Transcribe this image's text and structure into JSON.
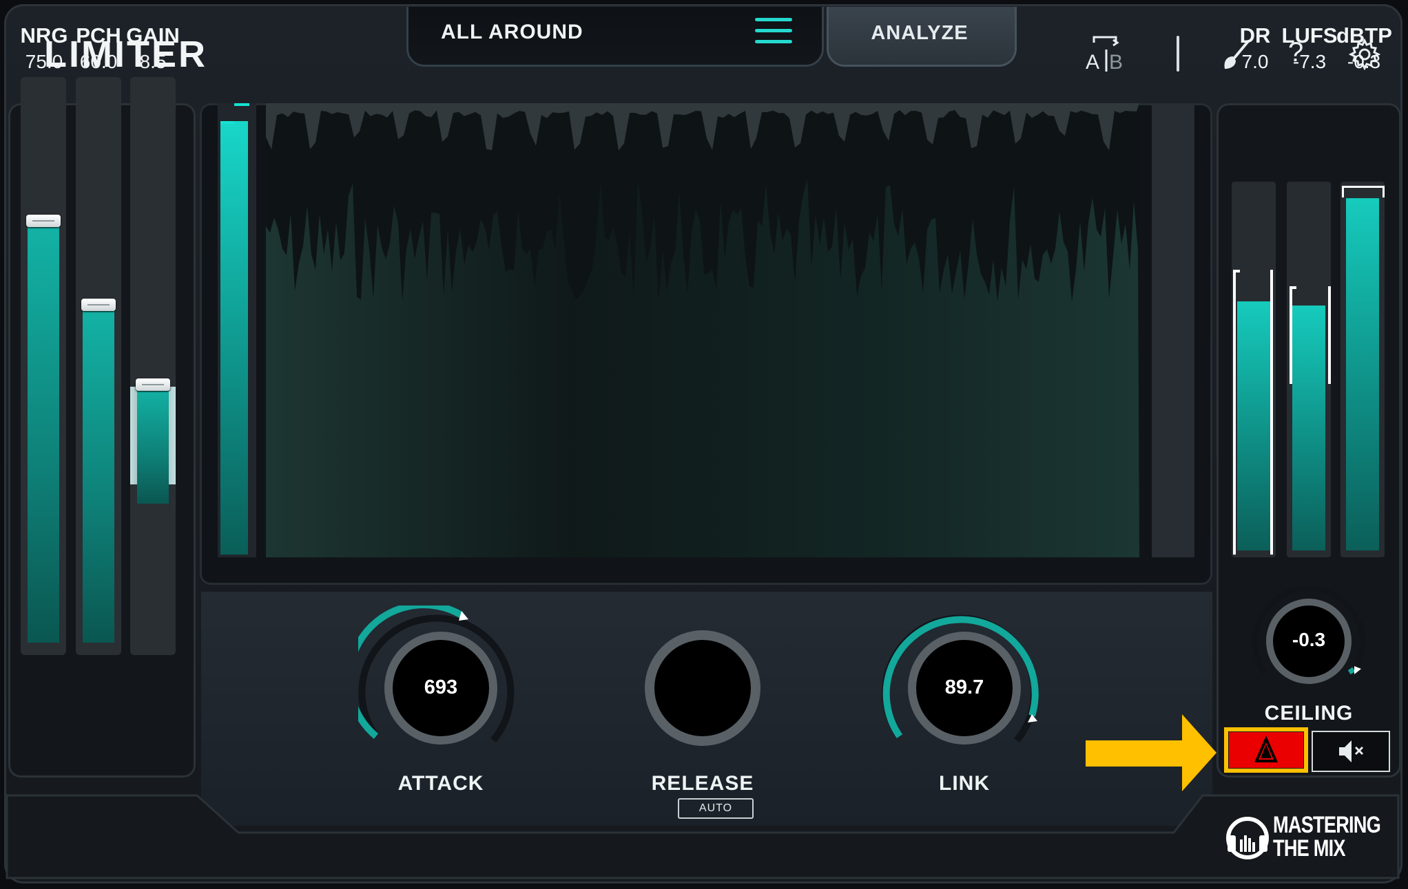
{
  "app": {
    "title": "LIMITER"
  },
  "header": {
    "preset_name": "ALL AROUND",
    "analyze_label": "ANALYZE",
    "ab_icon": "ab-compare-icon",
    "brush_icon": "brush-icon",
    "help_label": "?",
    "gear_icon": "gear-icon"
  },
  "left_meters": [
    {
      "label": "NRG",
      "value": "75.0",
      "level": 0.75
    },
    {
      "label": "PCH",
      "value": "60.0",
      "level": 0.6
    },
    {
      "label": "GAIN",
      "value": "8.5",
      "level": 0.28
    }
  ],
  "knobs": {
    "attack": {
      "label": "ATTACK",
      "value": "693"
    },
    "release": {
      "label": "RELEASE",
      "value": "",
      "badge": "AUTO"
    },
    "link": {
      "label": "LINK",
      "value": "89.7"
    }
  },
  "right_meters": [
    {
      "label": "DR",
      "value": "7.0"
    },
    {
      "label": "LUFS",
      "value": "-7.3"
    },
    {
      "label": "dBTP",
      "value": "-0.3"
    }
  ],
  "ceiling": {
    "label": "CEILING",
    "value": "-0.3"
  },
  "buttons": {
    "warning_icon": "warning-triangle-icon",
    "mute_icon": "speaker-mute-icon"
  },
  "branding": {
    "line1": "MASTERING",
    "line2": "THE MIX"
  },
  "colors": {
    "accent": "#18d7c9",
    "highlight": "#ffc000",
    "warning": "#ea0000"
  }
}
